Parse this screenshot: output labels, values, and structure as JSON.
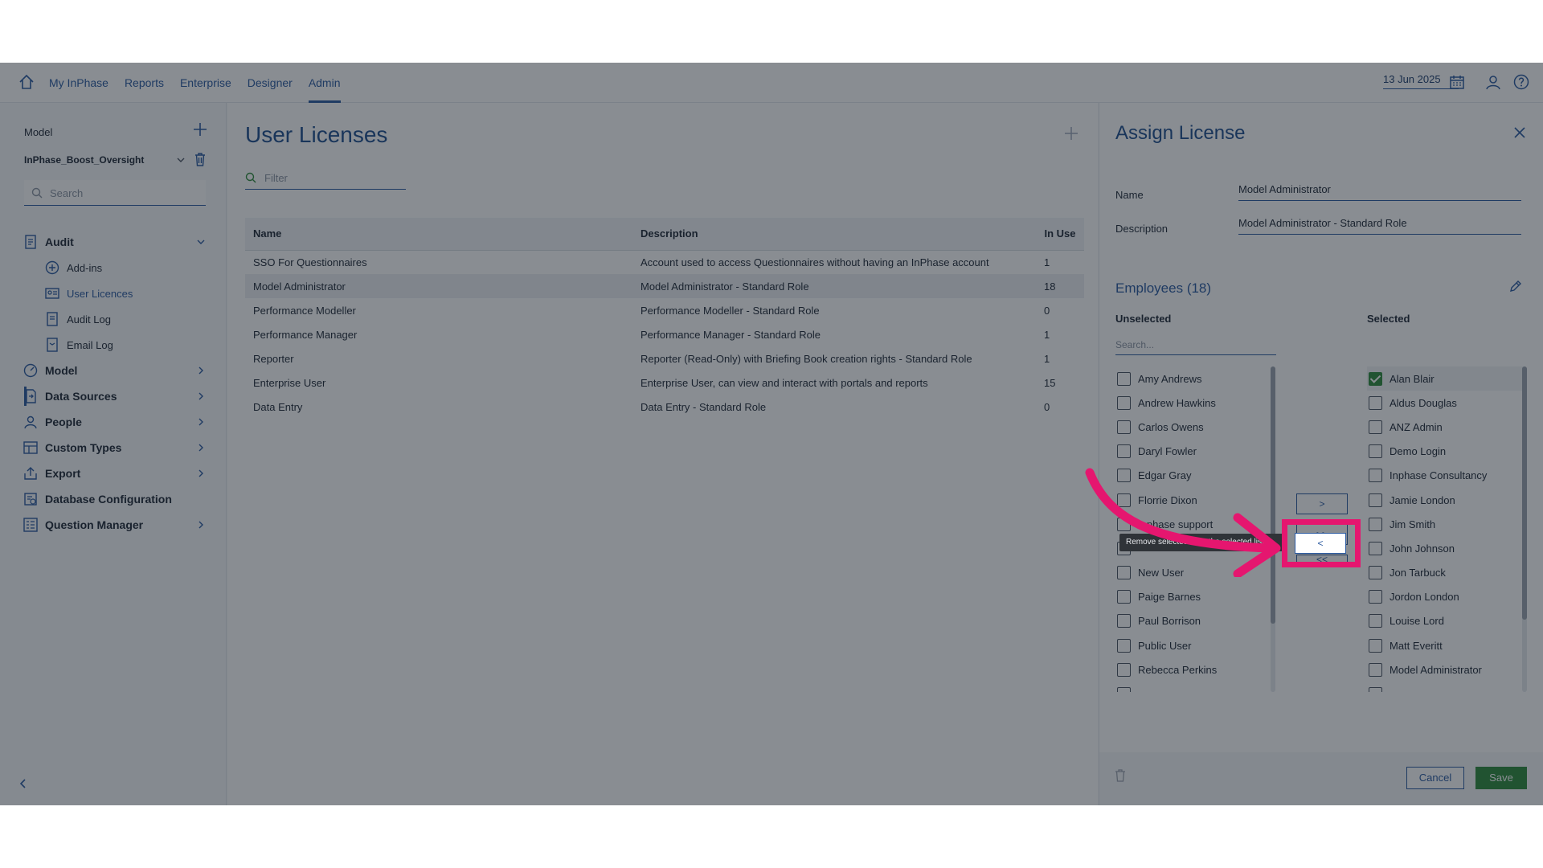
{
  "nav": {
    "items": [
      {
        "label": "My InPhase",
        "active": false
      },
      {
        "label": "Reports",
        "active": false
      },
      {
        "label": "Enterprise",
        "active": false
      },
      {
        "label": "Designer",
        "active": false
      },
      {
        "label": "Admin",
        "active": true
      }
    ],
    "date": "13 Jun 2025"
  },
  "sidebar": {
    "model_label": "Model",
    "model_name": "InPhase_Boost_Oversight",
    "search_placeholder": "Search",
    "audit": "Audit",
    "audit_children": [
      "Add-ins",
      "User Licences",
      "Audit Log",
      "Email Log"
    ],
    "sections": [
      "Model",
      "Data Sources",
      "People",
      "Custom Types",
      "Export",
      "Database Configuration",
      "Question Manager"
    ]
  },
  "main": {
    "title": "User Licenses",
    "filter_placeholder": "Filter",
    "columns": [
      "Name",
      "Description",
      "In Use"
    ],
    "rows": [
      {
        "name": "SSO For Questionnaires",
        "description": "Account used to access Questionnaires without having an InPhase account",
        "in_use": "1"
      },
      {
        "name": "Model Administrator",
        "description": "Model Administrator - Standard Role",
        "in_use": "18"
      },
      {
        "name": "Performance Modeller",
        "description": "Performance Modeller - Standard Role",
        "in_use": "0"
      },
      {
        "name": "Performance Manager",
        "description": "Performance Manager - Standard Role",
        "in_use": "1"
      },
      {
        "name": "Reporter",
        "description": "Reporter (Read-Only) with Briefing Book creation rights - Standard Role",
        "in_use": "1"
      },
      {
        "name": "Enterprise User",
        "description": "Enterprise User, can view and interact with portals and reports",
        "in_use": "15"
      },
      {
        "name": "Data Entry",
        "description": "Data Entry - Standard Role",
        "in_use": "0"
      }
    ]
  },
  "panel": {
    "title": "Assign License",
    "name_label": "Name",
    "name_value": "Model Administrator",
    "description_label": "Description",
    "description_value": "Model Administrator - Standard Role",
    "employees_title": "Employees (18)",
    "unselected_label": "Unselected",
    "selected_label": "Selected",
    "unselected_search_placeholder": "Search...",
    "unselected": [
      "Amy Andrews",
      "Andrew Hawkins",
      "Carlos Owens",
      "Daryl Fowler",
      "Edgar Gray",
      "Florrie Dixon",
      "Inphase support",
      "",
      "New User",
      "Paige Barnes",
      "Paul Borrison",
      "Public User",
      "Rebecca Perkins"
    ],
    "selected": [
      "Alan Blair",
      "Aldus Douglas",
      "ANZ Admin",
      "Demo Login",
      "Inphase Consultancy",
      "Jamie London",
      "Jim Smith",
      "John Johnson",
      "Jon Tarbuck",
      "Jordon London",
      "Louise Lord",
      "Matt Everitt",
      "Model Administrator"
    ],
    "move_buttons": [
      ">",
      ">>",
      "<<",
      "<"
    ],
    "tooltip": "Remove selected from the selected list",
    "cancel_label": "Cancel",
    "save_label": "Save"
  },
  "colors": {
    "accent": "#2b5aa0",
    "save": "#2e8b3c",
    "highlight": "#e5166f"
  }
}
